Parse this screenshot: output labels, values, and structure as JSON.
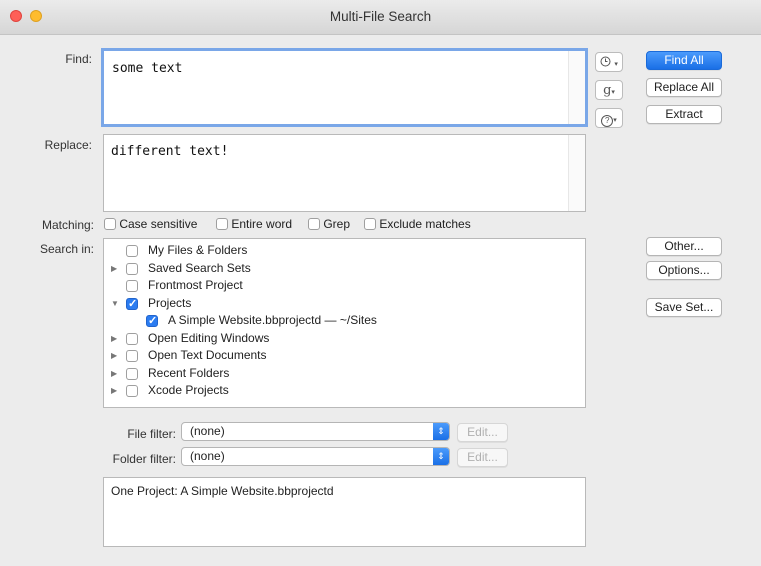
{
  "window": {
    "title": "Multi-File Search"
  },
  "colors": {
    "close": "#fe5f57",
    "minimize": "#febc2e",
    "accent": "#1a6fe6"
  },
  "find": {
    "label": "Find:",
    "value": "some text"
  },
  "replace": {
    "label": "Replace:",
    "value": "different text!"
  },
  "tools": {
    "history_icon": "clock-icon",
    "grep_icon": "g",
    "help_icon": "?"
  },
  "actions": {
    "find_all": "Find All",
    "replace_all": "Replace All",
    "extract": "Extract"
  },
  "matching": {
    "label": "Matching:",
    "options": [
      {
        "label": "Case sensitive",
        "checked": false
      },
      {
        "label": "Entire word",
        "checked": false
      },
      {
        "label": "Grep",
        "checked": false
      },
      {
        "label": "Exclude matches",
        "checked": false
      }
    ]
  },
  "search_in": {
    "label": "Search in:",
    "items": [
      {
        "label": "My Files & Folders",
        "checked": false,
        "expander": "none",
        "indent": 0
      },
      {
        "label": "Saved Search Sets",
        "checked": false,
        "expander": "collapsed",
        "indent": 0
      },
      {
        "label": "Frontmost Project",
        "checked": false,
        "expander": "none",
        "indent": 0
      },
      {
        "label": "Projects",
        "checked": true,
        "expander": "expanded",
        "indent": 0
      },
      {
        "label": "A Simple Website.bbprojectd — ~/Sites",
        "checked": true,
        "expander": "none",
        "indent": 1
      },
      {
        "label": "Open Editing Windows",
        "checked": false,
        "expander": "collapsed",
        "indent": 0
      },
      {
        "label": "Open Text Documents",
        "checked": false,
        "expander": "collapsed",
        "indent": 0
      },
      {
        "label": "Recent Folders",
        "checked": false,
        "expander": "collapsed",
        "indent": 0
      },
      {
        "label": "Xcode Projects",
        "checked": false,
        "expander": "collapsed",
        "indent": 0
      }
    ]
  },
  "side_buttons": {
    "other": "Other...",
    "options": "Options...",
    "save_set": "Save Set..."
  },
  "file_filter": {
    "label": "File filter:",
    "value": "(none)",
    "edit": "Edit..."
  },
  "folder_filter": {
    "label": "Folder filter:",
    "value": "(none)",
    "edit": "Edit..."
  },
  "summary": {
    "text": "One Project: A Simple Website.bbprojectd"
  }
}
